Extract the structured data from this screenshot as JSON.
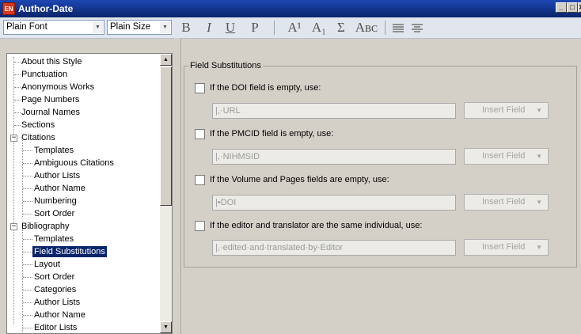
{
  "window": {
    "title": "Author-Date",
    "app_icon": "EN",
    "buttons": {
      "minimize": "_",
      "maximize": "□",
      "close": "✕"
    }
  },
  "toolbar": {
    "font_select": "Plain Font",
    "size_select": "Plain Size",
    "bold": "B",
    "italic": "I",
    "underline": "U",
    "plain": "P",
    "superscript": "A¹",
    "subscript": "A₁",
    "symbol": "Σ",
    "small_caps": "Aʙᴄ"
  },
  "sidebar": {
    "items": [
      {
        "label": "About this Style",
        "level": 1
      },
      {
        "label": "Punctuation",
        "level": 1
      },
      {
        "label": "Anonymous Works",
        "level": 1
      },
      {
        "label": "Page Numbers",
        "level": 1
      },
      {
        "label": "Journal Names",
        "level": 1
      },
      {
        "label": "Sections",
        "level": 1
      },
      {
        "label": "Citations",
        "level": 1,
        "expanded": true
      },
      {
        "label": "Templates",
        "level": 2
      },
      {
        "label": "Ambiguous Citations",
        "level": 2
      },
      {
        "label": "Author Lists",
        "level": 2
      },
      {
        "label": "Author Name",
        "level": 2
      },
      {
        "label": "Numbering",
        "level": 2
      },
      {
        "label": "Sort Order",
        "level": 2
      },
      {
        "label": "Bibliography",
        "level": 1,
        "expanded": true
      },
      {
        "label": "Templates",
        "level": 2
      },
      {
        "label": "Field Substitutions",
        "level": 2,
        "selected": true
      },
      {
        "label": "Layout",
        "level": 2
      },
      {
        "label": "Sort Order",
        "level": 2
      },
      {
        "label": "Categories",
        "level": 2
      },
      {
        "label": "Author Lists",
        "level": 2
      },
      {
        "label": "Author Name",
        "level": 2
      },
      {
        "label": "Editor Lists",
        "level": 2
      }
    ]
  },
  "main": {
    "group_title": "Field Substitutions",
    "rows": [
      {
        "checkbox_label": "If the DOI field is empty, use:",
        "checked": false,
        "field_value": "|,·URL",
        "button_label": "Insert Field"
      },
      {
        "checkbox_label": "If the PMCID field is empty, use:",
        "checked": false,
        "field_value": "|,·NIHMSID",
        "button_label": "Insert Field"
      },
      {
        "checkbox_label": "If the Volume and Pages fields are empty, use:",
        "checked": false,
        "field_value": "|•DOI",
        "button_label": "Insert Field"
      },
      {
        "checkbox_label": "If the editor and translator are the same individual, use:",
        "checked": false,
        "field_value": "|,·edited·and·translated·by·Editor",
        "button_label": "Insert Field"
      }
    ]
  },
  "colors": {
    "titlebar": "#0a246a",
    "selection": "#0a246a",
    "window_bg": "#d4d0c8"
  }
}
